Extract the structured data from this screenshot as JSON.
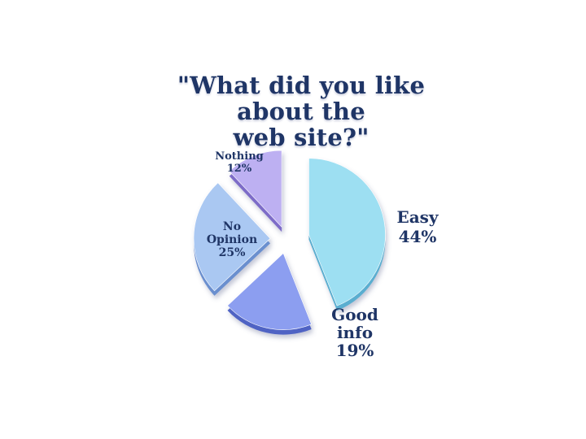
{
  "chart_data": {
    "type": "pie",
    "title_lines": [
      "\"What did you like",
      "about the",
      "web site?\""
    ],
    "slices": [
      {
        "label_lines": [
          "Easy",
          "44%"
        ],
        "value": 44,
        "color": "#9ddff2",
        "side": "#5aaed0"
      },
      {
        "label_lines": [
          "Good",
          "info",
          "19%"
        ],
        "value": 19,
        "color": "#8c9ef0",
        "side": "#4f63c4"
      },
      {
        "label_lines": [
          "No",
          "Opinion",
          "25%"
        ],
        "value": 25,
        "color": "#aac8f2",
        "side": "#6b8fcf"
      },
      {
        "label_lines": [
          "Nothing",
          "12%"
        ],
        "value": 12,
        "color": "#bdb0f2",
        "side": "#7d6cc8"
      }
    ],
    "exploded": true,
    "legend": "none"
  }
}
